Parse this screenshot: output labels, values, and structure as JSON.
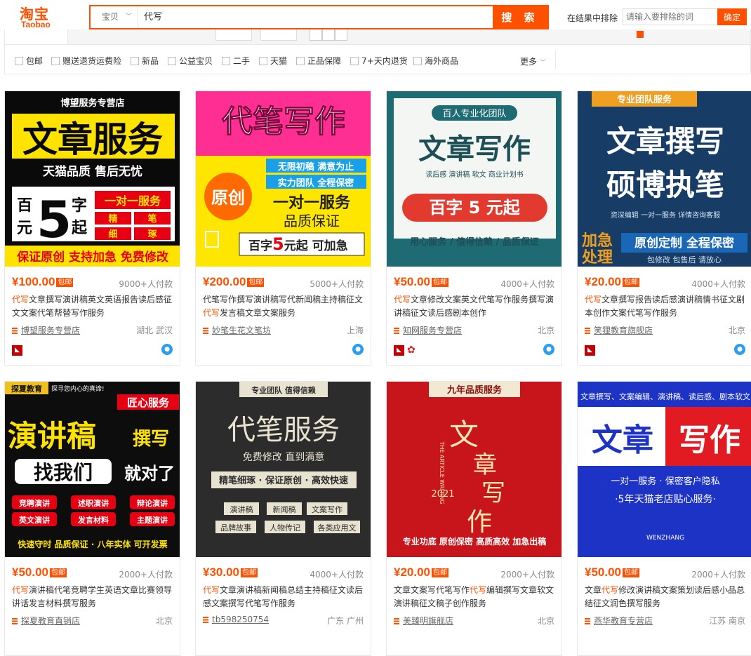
{
  "header": {
    "logo_cn": "淘宝",
    "logo_en": "Taobao",
    "search_category": "宝贝",
    "search_query": "代写",
    "search_button": "搜 索",
    "exclude_label": "在结果中排除",
    "exclude_placeholder": "请输入要排除的词",
    "exclude_button": "确定"
  },
  "filters": [
    "包邮",
    "赠送退货运费险",
    "新品",
    "公益宝贝",
    "二手",
    "天猫",
    "正品保障",
    "7+天内退货",
    "海外商品"
  ],
  "filters_more": "更多",
  "colors": {
    "accent": "#ff5000",
    "tmall_red": "#c40000"
  },
  "products": [
    {
      "price": "¥100.00",
      "baoyou": "包邮",
      "sales": "9000+人付款",
      "title_hl": "代写",
      "title_rest": "文章撰写演讲稿英文英语报告读后感征文文案代笔帮替写作服务",
      "shop": "博望服务专营店",
      "location": "湖北 武汉",
      "badges": [
        "tmall"
      ],
      "image": {
        "top": "博望服务专营店",
        "main": "文章服务",
        "sub": "天猫品质 售后无忧",
        "left_top": "百",
        "left_bottom": "元",
        "number": "5",
        "right_top": "字",
        "right_bottom": "起",
        "box_title": "一对一服务",
        "box_cells": [
          "精",
          "笔",
          "细",
          "琢"
        ],
        "bottom": "保证原创 支持加急 免费修改"
      }
    },
    {
      "price": "¥200.00",
      "baoyou": "包邮",
      "sales": "5000+人付款",
      "title_hl": "",
      "title_rest": "代笔写作撰写演讲稿写代新闻稿主持稿征文",
      "title_hl2": "代写",
      "title_rest2": "发言稿文章文案服务",
      "shop": "妙笔生花文笔坊",
      "location": "上海",
      "badges": [],
      "image": {
        "main": "代笔写作",
        "tag1": "无限初稿 满意为止",
        "tag2": "实力团队 全程保密",
        "circle": "原创",
        "line1": "一对一服务",
        "line2": "品质保证",
        "bottom_pre": "百字",
        "bottom_num": "5",
        "bottom_post": "元起 可加急"
      }
    },
    {
      "price": "¥50.00",
      "baoyou": "包邮",
      "sales": "4000+人付款",
      "title_hl": "代写",
      "title_rest": "文章修改文案英文代笔写作服务撰写演讲稿征文读后感剧本创作",
      "shop": "知网服务专营店",
      "location": "北京",
      "badges": [
        "tmall",
        "flower"
      ],
      "image": {
        "top": "百人专业化团队",
        "main": "文章写作",
        "sub": "读后感   演讲稿   软文   商业计划书",
        "banner": "百字 5 元起",
        "bottom": "用心服务 / 值得信赖 / 品质保证"
      }
    },
    {
      "price": "¥20.00",
      "baoyou": "包邮",
      "sales": "4000+人付款",
      "title_hl": "代写",
      "title_rest": "文章撰写报告读后感演讲稿情书征文剧本创作文案代笔写作服务",
      "shop": "笑狸教育旗舰店",
      "location": "北京",
      "badges": [
        "tmall"
      ],
      "image": {
        "top": "专业团队服务",
        "line1": "文章撰写",
        "line2": "硕博执笔",
        "sub": "资深编辑   一对一服务   详情咨询客服",
        "urgent1": "加急",
        "urgent2": "处理",
        "banner": "原创定制 全程保密",
        "foot": "包修改  包售后  请放心"
      }
    },
    {
      "price": "¥50.00",
      "baoyou": "包邮",
      "sales": "2000+人付款",
      "title_hl": "代写",
      "title_rest": "演讲稿代笔竞聘学生英语文章比赛领导讲话发言材料撰写服务",
      "shop": "探夏教育直销店",
      "location": "北京",
      "badges": [],
      "image": {
        "logo": "探夏教育",
        "slogan": "探寻您内心的真谛!",
        "tag": "匠心服务",
        "main": "演讲稿",
        "main_small": "撰写",
        "find": "找我们",
        "right": "就对了",
        "items": [
          "竞聘演讲",
          "述职演讲",
          "辩论演讲",
          "英文演讲",
          "发言材料",
          "主题演讲"
        ],
        "bottom": "快速守时  品质保证 · 八年实体  可开发票"
      }
    },
    {
      "price": "¥30.00",
      "baoyou": "包邮",
      "sales": "4000+人付款",
      "title_hl": "代写",
      "title_rest": "文章演讲稿新闻稿总结主持稿征文读后感文案撰写代笔写作服务",
      "shop": "tb598250754",
      "location": "广东 广州",
      "badges": [],
      "image": {
        "top": "专业团队 值得信赖",
        "main": "代笔服务",
        "sub": "免费修改 直到满意",
        "bar": "精笔细琢 · 保证原创 · 高效快速",
        "tags": [
          "演讲稿",
          "新闻稿",
          "文案写作",
          "品牌故事",
          "人物传记",
          "各类应用文"
        ]
      }
    },
    {
      "price": "¥20.00",
      "baoyou": "包邮",
      "sales": "2000+人付款",
      "title_pre": "文章文案写代笔写作",
      "title_hl": "代写",
      "title_rest": "编辑撰写文章软文演讲稿征文稿子创作服务",
      "shop": "美臻明旗舰店",
      "location": "北京",
      "badges": [],
      "image": {
        "top": "九年品质服务",
        "chars": [
          "文",
          "章",
          "写",
          "作"
        ],
        "en": "THE ARTICLE WRITING",
        "year": "2021",
        "bottom": "专业功底  原创保密  高质高效  加急出稿"
      }
    },
    {
      "price": "¥50.00",
      "baoyou": "包邮",
      "sales": "2000+人付款",
      "title_pre": "文章",
      "title_hl": "代写",
      "title_rest": "修改演讲稿文案策划读后感小品总结征文润色撰写服务",
      "shop": "燕华教育专营店",
      "location": "江苏 南京",
      "badges": [],
      "image": {
        "top": "文章撰写、文案编辑、演讲稿、读后感、剧本软文",
        "left": "文章",
        "right": "写作",
        "line1": "一对一服务 · 保密客户隐私",
        "line2": "·5年天猫老店贴心服务·",
        "foot": "WENZHANG"
      }
    }
  ]
}
